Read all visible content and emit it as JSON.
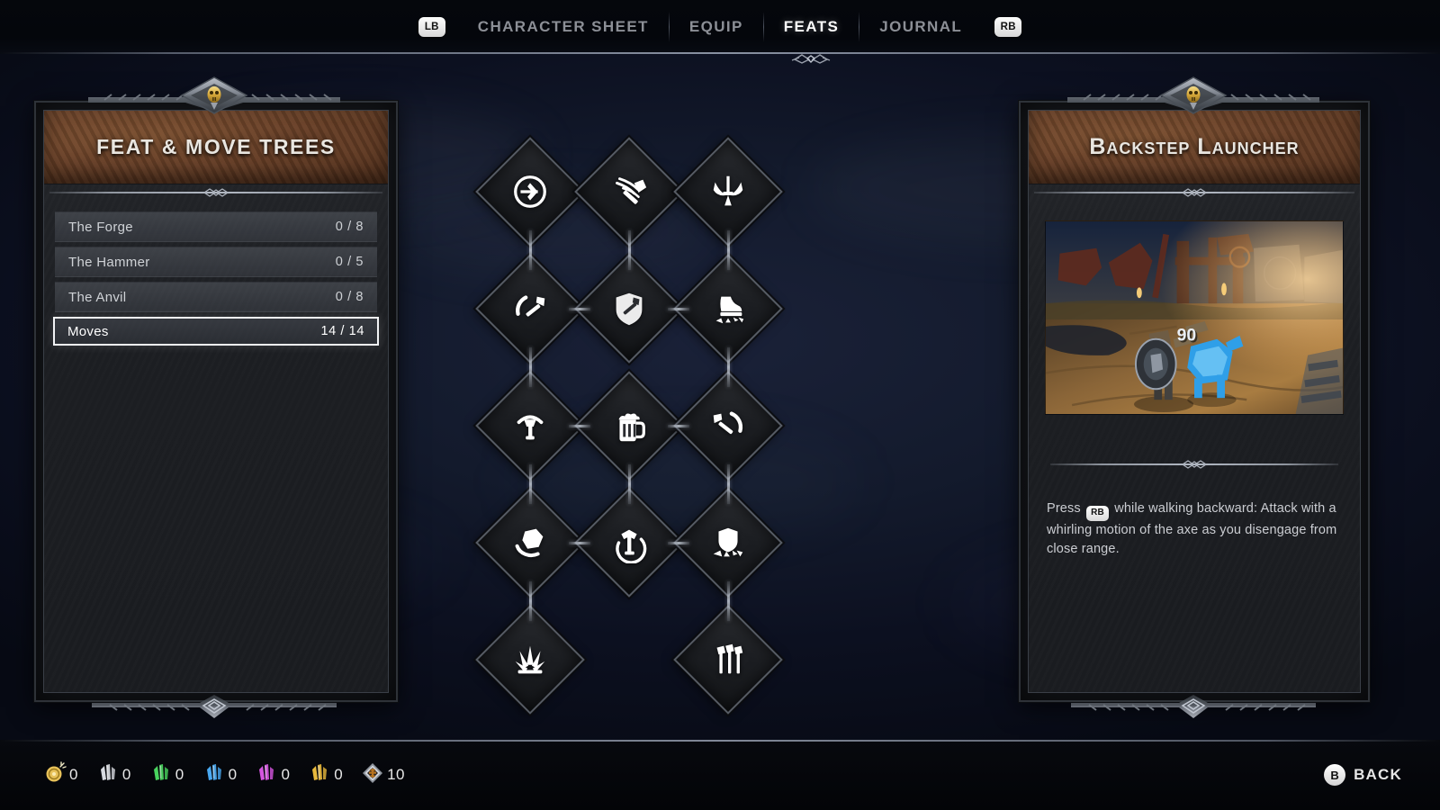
{
  "nav": {
    "left_bumper": "LB",
    "right_bumper": "RB",
    "tabs": [
      {
        "label": "CHARACTER SHEET",
        "active": false
      },
      {
        "label": "EQUIP",
        "active": false
      },
      {
        "label": "FEATS",
        "active": true
      },
      {
        "label": "JOURNAL",
        "active": false
      }
    ]
  },
  "left_panel": {
    "title": "FEAT & MOVE TREES",
    "rows": [
      {
        "name": "The Forge",
        "value": "0 / 8",
        "selected": false
      },
      {
        "name": "The Hammer",
        "value": "0 / 5",
        "selected": false
      },
      {
        "name": "The Anvil",
        "value": "0 / 8",
        "selected": false
      },
      {
        "name": "Moves",
        "value": "14 / 14",
        "selected": true
      }
    ]
  },
  "right_panel": {
    "title": "Backstep Launcher",
    "preview_damage_number": "90",
    "description_prefix": "Press",
    "description_button": "RB",
    "description_suffix": "while walking backward: Attack with a whirling motion of the axe as you disengage from close range."
  },
  "tree": {
    "nodes": [
      {
        "id": "n0",
        "icon": "axe-circle-icon",
        "col": 0,
        "row": 0
      },
      {
        "id": "n1",
        "icon": "axe-slash-icon",
        "col": 1,
        "row": 0
      },
      {
        "id": "n2",
        "icon": "horned-blade-icon",
        "col": 2,
        "row": 0
      },
      {
        "id": "n3",
        "icon": "crescent-axe-icon",
        "col": 0,
        "row": 1
      },
      {
        "id": "n4",
        "icon": "shield-axe-icon",
        "col": 1,
        "row": 1
      },
      {
        "id": "n5",
        "icon": "boot-stomp-icon",
        "col": 2,
        "row": 1
      },
      {
        "id": "n6",
        "icon": "scythe-axe-icon",
        "col": 0,
        "row": 2
      },
      {
        "id": "n7",
        "icon": "beer-mug-icon",
        "col": 1,
        "row": 2
      },
      {
        "id": "n8",
        "icon": "swing-axe-icon",
        "col": 2,
        "row": 2
      },
      {
        "id": "n9",
        "icon": "boulder-throw-icon",
        "col": 0,
        "row": 3
      },
      {
        "id": "n10",
        "icon": "axe-spin-circle-icon",
        "col": 1,
        "row": 3
      },
      {
        "id": "n11",
        "icon": "shield-bash-icon",
        "col": 2,
        "row": 3
      },
      {
        "id": "n12",
        "icon": "ground-burst-icon",
        "col": 0,
        "row": 4
      },
      {
        "id": "n13",
        "icon": "thrown-axes-icon",
        "col": 2,
        "row": 4
      }
    ],
    "links": [
      {
        "from": "n0",
        "to": "n3"
      },
      {
        "from": "n1",
        "to": "n4"
      },
      {
        "from": "n2",
        "to": "n5"
      },
      {
        "from": "n3",
        "to": "n4"
      },
      {
        "from": "n4",
        "to": "n5"
      },
      {
        "from": "n3",
        "to": "n6"
      },
      {
        "from": "n5",
        "to": "n8"
      },
      {
        "from": "n6",
        "to": "n7"
      },
      {
        "from": "n7",
        "to": "n8"
      },
      {
        "from": "n6",
        "to": "n9"
      },
      {
        "from": "n7",
        "to": "n10"
      },
      {
        "from": "n8",
        "to": "n11"
      },
      {
        "from": "n9",
        "to": "n10"
      },
      {
        "from": "n10",
        "to": "n11"
      },
      {
        "from": "n9",
        "to": "n12"
      },
      {
        "from": "n11",
        "to": "n13"
      }
    ]
  },
  "bottom_bar": {
    "currencies": [
      {
        "icon": "gold-coin-icon",
        "amount": "0",
        "color": "#e8c25a"
      },
      {
        "icon": "white-gem-icon",
        "amount": "0",
        "color": "#d7dae0"
      },
      {
        "icon": "green-gem-icon",
        "amount": "0",
        "color": "#49d45e"
      },
      {
        "icon": "blue-gem-icon",
        "amount": "0",
        "color": "#49a8f0"
      },
      {
        "icon": "purple-gem-icon",
        "amount": "0",
        "color": "#d455e0"
      },
      {
        "icon": "yellow-gem-icon",
        "amount": "0",
        "color": "#e8b93c"
      },
      {
        "icon": "feat-point-icon",
        "amount": "10",
        "color": "#b9741f"
      }
    ],
    "back_button_glyph": "B",
    "back_button_label": "BACK"
  }
}
